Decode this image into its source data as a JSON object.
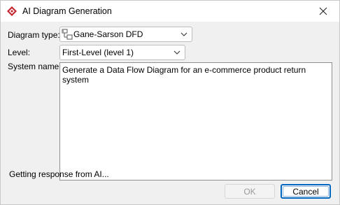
{
  "window": {
    "title": "AI Diagram Generation",
    "app_icon": "visual-paradigm-diamond-icon",
    "accent_color": "#c4262e"
  },
  "form": {
    "diagram_type_label": "Diagram type:",
    "diagram_type_value": "Gane-Sarson DFD",
    "diagram_type_icon": "dfd-diagram-icon",
    "level_label": "Level:",
    "level_value": "First-Level (level 1)",
    "system_name_label": "System name:",
    "system_name_value": "Generate a Data Flow Diagram for an e-commerce product return system"
  },
  "status_text": "Getting response from AI...",
  "buttons": {
    "ok_label": "OK",
    "ok_enabled": false,
    "cancel_label": "Cancel"
  }
}
